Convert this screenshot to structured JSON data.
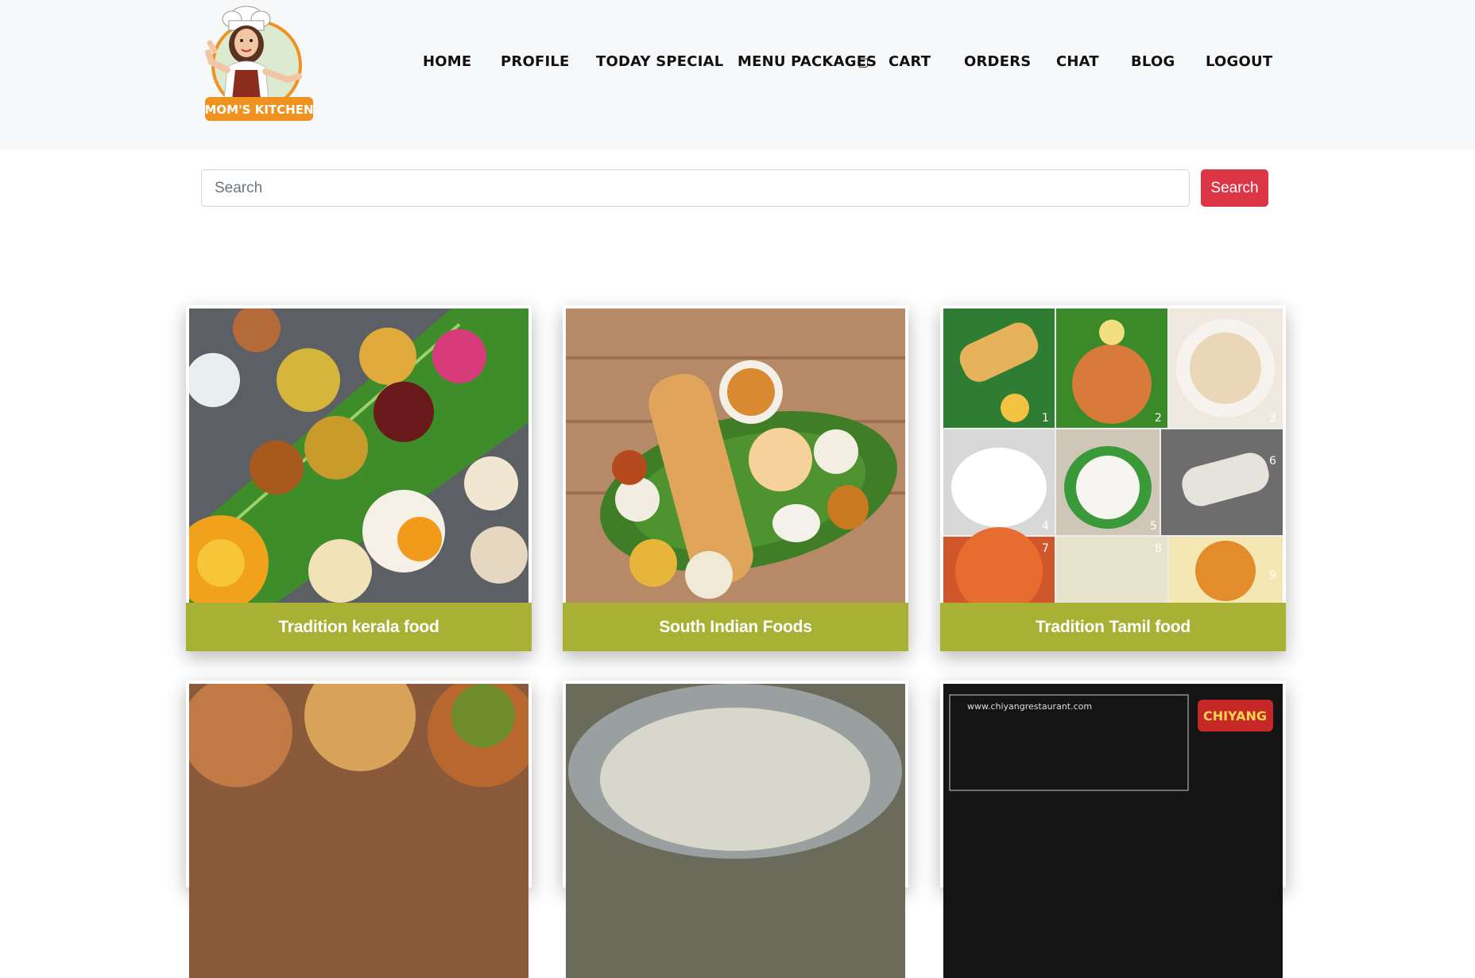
{
  "brand": {
    "logo_text": "MOM'S KITCHEN"
  },
  "nav": {
    "items": [
      {
        "label": "HOME"
      },
      {
        "label": "PROFILE"
      },
      {
        "label": "TODAY SPECIAL"
      },
      {
        "label": "MENU PACKAGES"
      },
      {
        "label": "CART"
      },
      {
        "label": "ORDERS"
      },
      {
        "label": "CHAT"
      },
      {
        "label": "BLOG"
      },
      {
        "label": "LOGOUT"
      }
    ],
    "dropdown_glyph": "▢"
  },
  "search": {
    "placeholder": "Search",
    "value": "",
    "button_label": "Search"
  },
  "cards": [
    {
      "title": "Tradition kerala food"
    },
    {
      "title": "South Indian Foods"
    },
    {
      "title": "Tradition Tamil food"
    }
  ],
  "partial_cards": [
    {
      "image_text": "www.chiyangrestaurant.com",
      "logo_text": "CHIYANG"
    }
  ],
  "colors": {
    "header_bg": "#f7f8f9",
    "search_button": "#dc3545",
    "caption_bg": "#a8b133",
    "logo_orange": "#f0921f"
  }
}
